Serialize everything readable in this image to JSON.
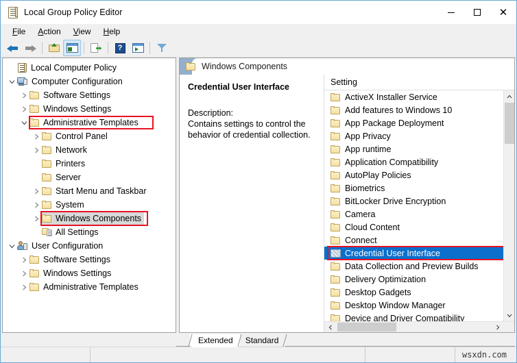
{
  "window": {
    "title": "Local Group Policy Editor",
    "icon": "policy-document-icon",
    "controls": {
      "minimize": "–",
      "maximize": "□",
      "close": "✕"
    }
  },
  "menu": [
    {
      "label": "File",
      "mnemonic": "F"
    },
    {
      "label": "Action",
      "mnemonic": "A"
    },
    {
      "label": "View",
      "mnemonic": "V"
    },
    {
      "label": "Help",
      "mnemonic": "H"
    }
  ],
  "toolbar": [
    {
      "name": "back-button",
      "icon": "arrow-left-icon",
      "label": "Back"
    },
    {
      "name": "forward-button",
      "icon": "arrow-right-icon",
      "label": "Forward"
    },
    {
      "name": "up-one-level-button",
      "icon": "folder-up-icon",
      "label": "Up One Level"
    },
    {
      "name": "show-hide-console-tree-button",
      "icon": "console-tree-icon",
      "label": "Show/Hide Console Tree"
    },
    {
      "name": "export-list-button",
      "icon": "export-list-icon",
      "label": "Export List"
    },
    {
      "name": "help-button",
      "icon": "question-mark-icon",
      "label": "Help"
    },
    {
      "name": "show-hide-action-pane-button",
      "icon": "action-pane-icon",
      "label": "Show/Hide Action Pane"
    },
    {
      "name": "filter-button",
      "icon": "filter-funnel-icon",
      "label": "Filter"
    }
  ],
  "tree": [
    {
      "label": "Local Computer Policy",
      "indent": 0,
      "twisty": "none",
      "icon": "policy-document-icon"
    },
    {
      "label": "Computer Configuration",
      "indent": 1,
      "twisty": "expanded",
      "icon": "computer-icon"
    },
    {
      "label": "Software Settings",
      "indent": 2,
      "twisty": "collapsed",
      "icon": "folder-icon"
    },
    {
      "label": "Windows Settings",
      "indent": 2,
      "twisty": "collapsed",
      "icon": "folder-icon"
    },
    {
      "label": "Administrative Templates",
      "indent": 2,
      "twisty": "expanded",
      "icon": "folder-icon",
      "highlight": "red-box"
    },
    {
      "label": "Control Panel",
      "indent": 3,
      "twisty": "collapsed",
      "icon": "folder-icon"
    },
    {
      "label": "Network",
      "indent": 3,
      "twisty": "collapsed",
      "icon": "folder-icon"
    },
    {
      "label": "Printers",
      "indent": 3,
      "twisty": "none",
      "icon": "folder-icon"
    },
    {
      "label": "Server",
      "indent": 3,
      "twisty": "none",
      "icon": "folder-icon"
    },
    {
      "label": "Start Menu and Taskbar",
      "indent": 3,
      "twisty": "collapsed",
      "icon": "folder-icon"
    },
    {
      "label": "System",
      "indent": 3,
      "twisty": "collapsed",
      "icon": "folder-icon"
    },
    {
      "label": "Windows Components",
      "indent": 3,
      "twisty": "collapsed",
      "icon": "folder-icon",
      "highlight": "red-box",
      "selected": true
    },
    {
      "label": "All Settings",
      "indent": 3,
      "twisty": "none",
      "icon": "all-settings-icon"
    },
    {
      "label": "User Configuration",
      "indent": 1,
      "twisty": "expanded",
      "icon": "user-icon"
    },
    {
      "label": "Software Settings",
      "indent": 2,
      "twisty": "collapsed",
      "icon": "folder-icon"
    },
    {
      "label": "Windows Settings",
      "indent": 2,
      "twisty": "collapsed",
      "icon": "folder-icon"
    },
    {
      "label": "Administrative Templates",
      "indent": 2,
      "twisty": "collapsed",
      "icon": "folder-icon"
    }
  ],
  "pane_header": {
    "title": "Windows Components",
    "icon": "folder-icon"
  },
  "description": {
    "title": "Credential User Interface",
    "label": "Description:",
    "text": "Contains settings to control the behavior of credential collection."
  },
  "settings_list": {
    "column_header": "Setting",
    "rows": [
      {
        "label": "ActiveX Installer Service",
        "icon": "folder-icon"
      },
      {
        "label": "Add features to Windows 10",
        "icon": "folder-icon"
      },
      {
        "label": "App Package Deployment",
        "icon": "folder-icon"
      },
      {
        "label": "App Privacy",
        "icon": "folder-icon"
      },
      {
        "label": "App runtime",
        "icon": "folder-icon"
      },
      {
        "label": "Application Compatibility",
        "icon": "folder-icon"
      },
      {
        "label": "AutoPlay Policies",
        "icon": "folder-icon"
      },
      {
        "label": "Biometrics",
        "icon": "folder-icon"
      },
      {
        "label": "BitLocker Drive Encryption",
        "icon": "folder-icon"
      },
      {
        "label": "Camera",
        "icon": "folder-icon"
      },
      {
        "label": "Cloud Content",
        "icon": "folder-icon"
      },
      {
        "label": "Connect",
        "icon": "folder-icon"
      },
      {
        "label": "Credential User Interface",
        "icon": "folder-selected-icon",
        "selected": true,
        "highlight": "red-box"
      },
      {
        "label": "Data Collection and Preview Builds",
        "icon": "folder-icon"
      },
      {
        "label": "Delivery Optimization",
        "icon": "folder-icon"
      },
      {
        "label": "Desktop Gadgets",
        "icon": "folder-icon"
      },
      {
        "label": "Desktop Window Manager",
        "icon": "folder-icon"
      },
      {
        "label": "Device and Driver Compatibility",
        "icon": "folder-icon"
      }
    ]
  },
  "scrollbars": {
    "vertical_up": "˄",
    "vertical_down": "˅",
    "horizontal_left": "‹",
    "horizontal_right": "›"
  },
  "tabs": [
    {
      "label": "Extended",
      "active": true
    },
    {
      "label": "Standard",
      "active": false
    }
  ],
  "statusbar": {
    "watermark": "wsxdn.com"
  },
  "colors": {
    "accent": "#0b6fcb",
    "annotation": "#e81123",
    "pane_header": "#93afcb",
    "window_border": "#6ba7d6"
  }
}
